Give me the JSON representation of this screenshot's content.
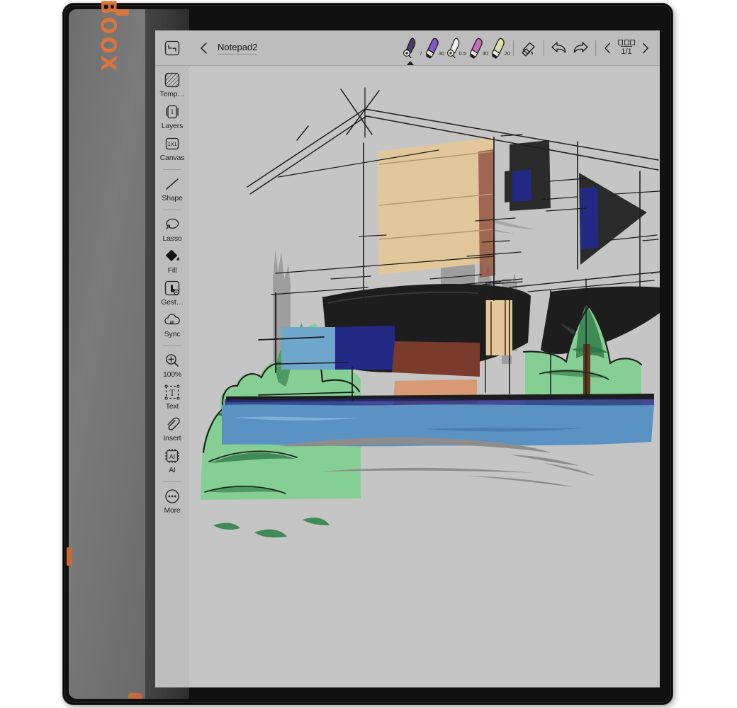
{
  "device": {
    "brand": "BOOX",
    "accent_color": "#d9753f",
    "bezel_color": "#0b0b0b",
    "screen_color": "#c5c5c5"
  },
  "topbar": {
    "back_icon": "chevron-left-icon",
    "title": "Notepad2",
    "tools": [
      {
        "name": "pen-ballpoint",
        "size": "7",
        "color": "#4a3b66",
        "type": "pen",
        "active": true
      },
      {
        "name": "pen-marker",
        "size": "30",
        "color": "#8257c8",
        "type": "marker",
        "active": false
      },
      {
        "name": "pen-fineliner",
        "size": "0.5",
        "color": "#f2f2ee",
        "type": "pen",
        "active": false
      },
      {
        "name": "pen-highlighter",
        "size": "30",
        "color": "#c86bb8",
        "type": "marker",
        "active": false
      },
      {
        "name": "pen-pencil",
        "size": "20",
        "color": "#dcdfa8",
        "type": "marker",
        "active": false
      }
    ],
    "eraser_icon": "eraser-icon",
    "undo_icon": "undo-arrow-icon",
    "redo_icon": "redo-arrow-icon",
    "page_prev_icon": "chevron-left-icon",
    "page_next_icon": "chevron-right-icon",
    "page_grid_icon": "page-grid-icon",
    "page_indicator": "1/1"
  },
  "sidebar": {
    "collapse_icon": "collapse-panel-icon",
    "items": [
      {
        "icon": "template-icon",
        "label": "Temp…"
      },
      {
        "icon": "layers-icon",
        "label": "Layers"
      },
      {
        "icon": "canvas-icon",
        "label": "Canvas"
      },
      {
        "icon": "shape-icon",
        "label": "Shape"
      },
      {
        "icon": "lasso-icon",
        "label": "Lasso"
      },
      {
        "icon": "fill-icon",
        "label": "Fill"
      },
      {
        "icon": "gesture-icon",
        "label": "Gest…"
      },
      {
        "icon": "sync-icon",
        "label": "Sync"
      },
      {
        "icon": "zoom-icon",
        "label": "100%"
      },
      {
        "icon": "text-icon",
        "label": "Text"
      },
      {
        "icon": "insert-icon",
        "label": "Insert"
      },
      {
        "icon": "ai-icon",
        "label": "AI"
      },
      {
        "icon": "more-icon",
        "label": "More"
      }
    ],
    "canvas_ratio": "1X1",
    "layer_number": "1",
    "ai_label": "AI"
  },
  "canvas": {
    "artwork_title": "architectural perspective sketch",
    "background": "#c5c5c5",
    "palette": {
      "foliage_light": "#86cf94",
      "foliage_dark": "#2f7a48",
      "water_blue": "#5b92c4",
      "deep_blue": "#232a86",
      "wall_tan": "#e2c79a",
      "wall_peach": "#d79a75",
      "roof_black": "#1d1d1d",
      "shadow_gray": "#8d8d8d",
      "sky_gray": "#9b9b9b",
      "brown": "#7a3a2c"
    }
  }
}
